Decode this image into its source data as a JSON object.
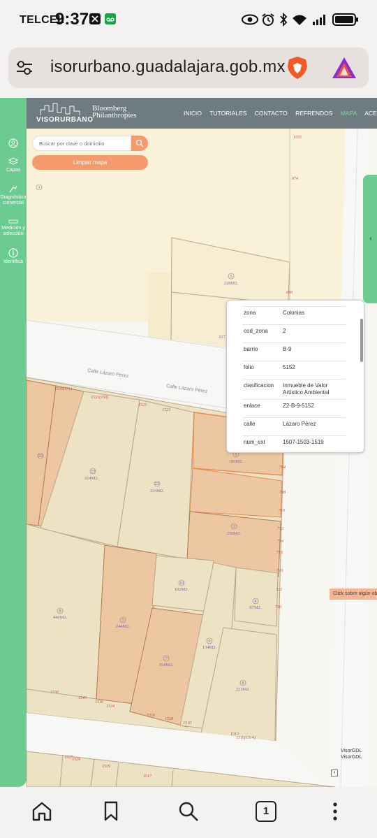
{
  "status_bar": {
    "carrier": "TELCEL",
    "time": "9:37"
  },
  "browser": {
    "url": "isorurbano.guadalajara.gob.mx",
    "tab_count": "1"
  },
  "header": {
    "logo_visor": "VISORURBANO",
    "logo_bloomberg_line1": "Bloomberg",
    "logo_bloomberg_line2": "Philanthropies",
    "nav": [
      "INICIO",
      "TUTORIALES",
      "CONTACTO",
      "REFRENDOS",
      "MAPA",
      "ACERCA DE"
    ]
  },
  "sidebar": {
    "items": [
      {
        "label": "",
        "icon": "user-icon"
      },
      {
        "label": "Capas",
        "icon": "layers-icon"
      },
      {
        "label": "Diagnóstico comercial",
        "icon": "hand-icon"
      },
      {
        "label": "Medición y selección",
        "icon": "ruler-icon"
      },
      {
        "label": "Identifica",
        "icon": "info-icon"
      }
    ]
  },
  "search": {
    "placeholder": "Buscar por clave o domicilio",
    "clear_label": "Limpiar mapa"
  },
  "popup": {
    "rows": [
      {
        "key": "zona",
        "value": "Colonias"
      },
      {
        "key": "cod_zona",
        "value": "2"
      },
      {
        "key": "barrio",
        "value": "B-9"
      },
      {
        "key": "folio",
        "value": "5152"
      },
      {
        "key": "clasificacion",
        "value": "Inmueble de Valor Artístico Ambiental"
      },
      {
        "key": "enlace",
        "value": "Z2-B-9-5152"
      },
      {
        "key": "calle",
        "value": "Lázaro Pérez"
      },
      {
        "key": "num_ext",
        "value": "1507-1503-1519"
      }
    ]
  },
  "map": {
    "streets": [
      "Calle Lázaro Pérez",
      "Calle Lázaro Pérez"
    ],
    "parcels": [
      {
        "num": "1",
        "area": ""
      },
      {
        "num": "5",
        "area": "228M2."
      },
      {
        "num": "",
        "area": "227"
      },
      {
        "num": "1",
        "area": "190M2."
      },
      {
        "num": "23",
        "area": "324M2."
      },
      {
        "num": "22",
        "area": "334M2."
      },
      {
        "num": "2",
        "area": "256M2."
      },
      {
        "num": "10",
        "area": "102M2."
      },
      {
        "num": "4",
        "area": "87M2."
      },
      {
        "num": "8",
        "area": "440M2."
      },
      {
        "num": "5",
        "area": "244M2."
      },
      {
        "num": "6",
        "area": "134M2."
      },
      {
        "num": "7",
        "area": "194M2."
      },
      {
        "num": "8",
        "area": "223M2."
      },
      {
        "num": "25",
        "area": ""
      }
    ],
    "address_numbers": [
      "1555",
      "674",
      "690",
      "1530(151)",
      "1531(150)",
      "1525",
      "1523",
      "704",
      "708",
      "710",
      "712",
      "714",
      "716",
      "720",
      "722",
      "730",
      "1530",
      "1540",
      "1536",
      "1534",
      "1516",
      "1528",
      "1510",
      "1512",
      "1510(1514)",
      "1527",
      "1529",
      "1519",
      "1517"
    ],
    "hint": "Click sobre algún obje",
    "legend": [
      "VisorGDL",
      "VisorGDL"
    ],
    "info_label": "i"
  },
  "colors": {
    "sidebar_green": "#6ccb91",
    "nav_gray": "#6e7b80",
    "accent_orange": "#f59a6c",
    "parcel_cream": "#eee2c5",
    "parcel_orange": "#edc7a2"
  }
}
